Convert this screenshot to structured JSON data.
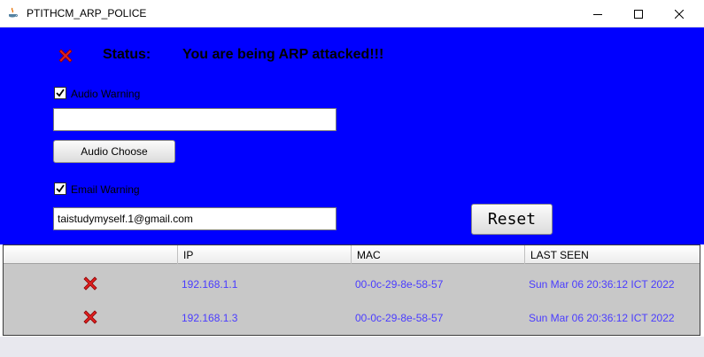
{
  "window": {
    "title": "PTITHCM_ARP_POLICE"
  },
  "status": {
    "label": "Status:",
    "message": "You are being ARP attacked!!!"
  },
  "audio": {
    "checkbox_label": "Audio Warning",
    "checked": true,
    "path_value": "",
    "choose_button": "Audio Choose"
  },
  "email": {
    "checkbox_label": "Email Warning",
    "checked": true,
    "address_value": "taistudymyself.1@gmail.com"
  },
  "reset_button": "Reset",
  "table": {
    "columns": [
      "",
      "IP",
      "MAC",
      "LAST SEEN"
    ],
    "rows": [
      {
        "status_icon": "red-x-icon",
        "ip": "192.168.1.1",
        "mac": "00-0c-29-8e-58-57",
        "last_seen": "Sun Mar 06 20:36:12 ICT 2022"
      },
      {
        "status_icon": "red-x-icon",
        "ip": "192.168.1.3",
        "mac": "00-0c-29-8e-58-57",
        "last_seen": "Sun Mar 06 20:36:12 ICT 2022"
      }
    ]
  },
  "colors": {
    "panel_bg": "#0000ff",
    "table_text": "#4a3cff",
    "alert_icon": "#e02020"
  }
}
